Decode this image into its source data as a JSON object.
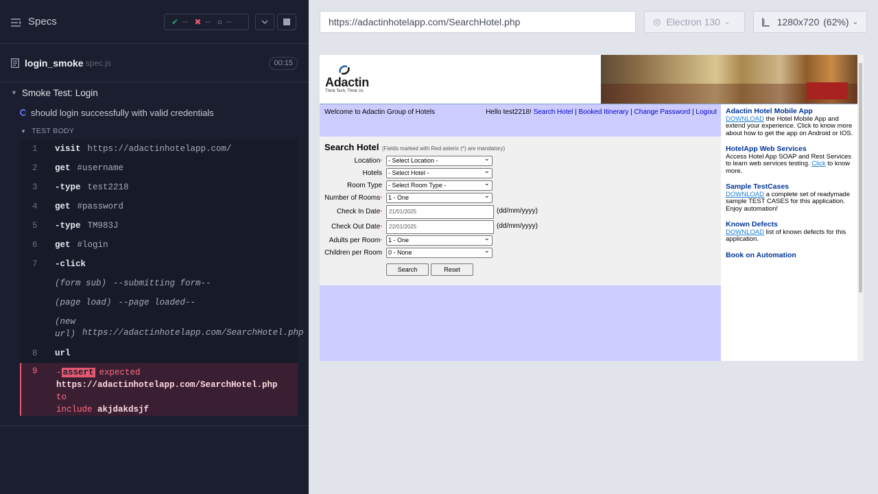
{
  "runner": {
    "specs_label": "Specs",
    "stats": {
      "passed": "--",
      "failed": "--",
      "pending": "--"
    },
    "spec": {
      "name": "login_smoke",
      "ext": "spec.js",
      "duration": "00:15"
    },
    "suite_title": "Smoke Test: Login",
    "test_title": "should login successfully with valid credentials",
    "test_body_label": "TEST BODY",
    "commands": [
      {
        "num": "1",
        "name": "visit",
        "msg": "https://adactinhotelapp.com/"
      },
      {
        "num": "2",
        "name": "get",
        "msg": "#username"
      },
      {
        "num": "3",
        "name": "-type",
        "msg": "test2218"
      },
      {
        "num": "4",
        "name": "get",
        "msg": "#password"
      },
      {
        "num": "5",
        "name": "-type",
        "msg": "TM983J"
      },
      {
        "num": "6",
        "name": "get",
        "msg": "#login"
      },
      {
        "num": "7",
        "name": "-click",
        "msg": ""
      }
    ],
    "events": [
      {
        "name": "(form sub)",
        "msg": "--submitting form--"
      },
      {
        "name": "(page load)",
        "msg": "--page loaded--"
      },
      {
        "name": "(new url)",
        "msg": "https://adactinhotelapp.com/SearchHotel.php"
      }
    ],
    "cmd8": {
      "num": "8",
      "name": "url"
    },
    "assert": {
      "num": "9",
      "dash": "-",
      "badge": "assert",
      "word_expected": "expected",
      "actual": "https://adactinhotelapp.com/SearchHotel.php",
      "word_to": "to",
      "word_include": "include",
      "expected": "akjdakdsjf"
    }
  },
  "aut": {
    "url": "https://adactinhotelapp.com/SearchHotel.php",
    "browser": "Electron 130",
    "viewport": "1280x720",
    "zoom": "(62%)"
  },
  "adactin": {
    "logo_word": "Adactin",
    "logo_tag": "Think Tech, Think Us",
    "welcome": "Welcome to Adactin Group of Hotels",
    "hello": "Hello test2218!",
    "nav_links": [
      "Search Hotel",
      "Booked Itinerary",
      "Change Password",
      "Logout"
    ],
    "title": "Search Hotel",
    "note": "(Fields marked with Red asterix (*) are mandatory)",
    "fields": {
      "location": {
        "label": "Location",
        "value": "- Select Location -"
      },
      "hotels": {
        "label": "Hotels",
        "value": "- Select Hotel -"
      },
      "room_type": {
        "label": "Room Type",
        "value": "- Select Room Type -"
      },
      "rooms": {
        "label": "Number of Rooms",
        "value": "1 - One"
      },
      "checkin": {
        "label": "Check In Date",
        "value": "21/01/2025",
        "format": "(dd/mm/yyyy)"
      },
      "checkout": {
        "label": "Check Out Date",
        "value": "22/01/2025",
        "format": "(dd/mm/yyyy)"
      },
      "adults": {
        "label": "Adults per Room",
        "value": "1 - One"
      },
      "children": {
        "label": "Children per Room",
        "value": "0 - None"
      }
    },
    "search_btn": "Search",
    "reset_btn": "Reset",
    "side": [
      {
        "title": "Adactin Hotel Mobile App",
        "link": "DOWNLOAD",
        "pre": "",
        "post": " the Hotel Mobile App and extend your experience. Click to know more about how to get the app on Android or IOS."
      },
      {
        "title": "HotelApp Web Services",
        "link": "Click",
        "pre": "Access Hotel App SOAP and Rest Services to learn web services testing. ",
        "post": " to know more."
      },
      {
        "title": "Sample TestCases",
        "link": "DOWNLOAD",
        "pre": "",
        "post": " a complete set of readymade sample TEST CASES for this application. Enjoy automation!"
      },
      {
        "title": "Known Defects",
        "link": "DOWNLOAD",
        "pre": "",
        "post": " list of known defects for this application."
      },
      {
        "title": "Book on Automation",
        "link": "",
        "pre": "",
        "post": ""
      }
    ]
  }
}
